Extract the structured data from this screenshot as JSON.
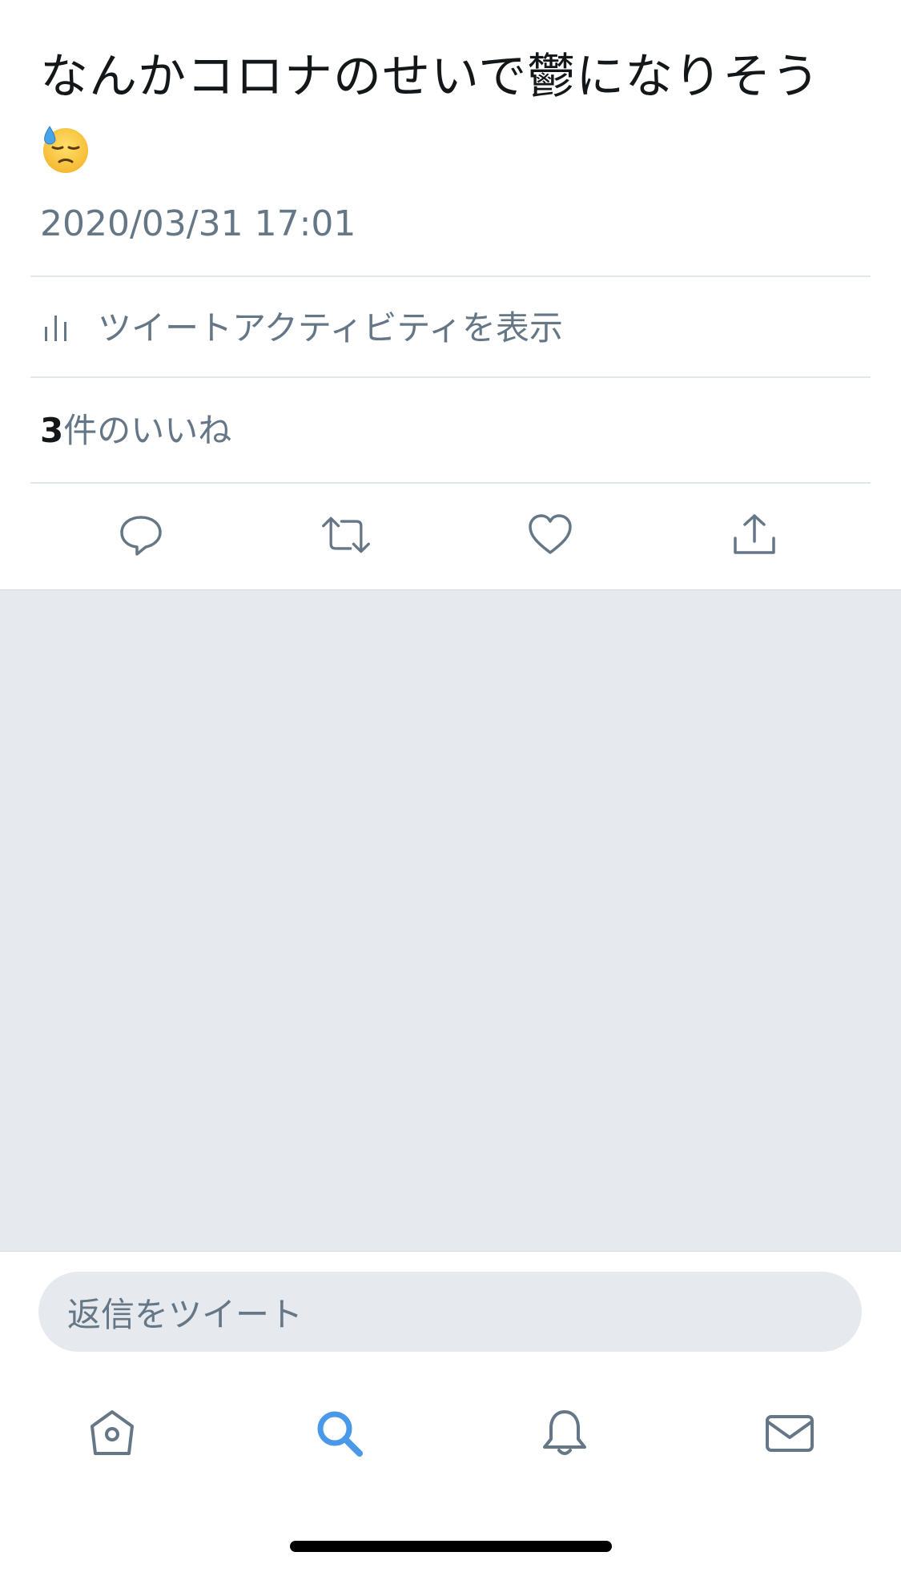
{
  "tweet": {
    "text": "なんかコロナのせいで鬱になりそう",
    "emoji": "downcast-face-with-sweat",
    "timestamp": "2020/03/31 17:01"
  },
  "activity": {
    "label": "ツイートアクティビティを表示",
    "icon": "bar-chart-icon"
  },
  "likes": {
    "count": "3",
    "label": "件のいいね"
  },
  "actions": [
    {
      "name": "reply",
      "icon": "reply-icon"
    },
    {
      "name": "retweet",
      "icon": "retweet-icon"
    },
    {
      "name": "like",
      "icon": "heart-icon"
    },
    {
      "name": "share",
      "icon": "share-icon"
    }
  ],
  "reply_box": {
    "placeholder": "返信をツイート"
  },
  "tabbar": [
    {
      "name": "home",
      "icon": "home-icon",
      "active": false
    },
    {
      "name": "search",
      "icon": "search-icon",
      "active": true
    },
    {
      "name": "notifications",
      "icon": "bell-icon",
      "active": false
    },
    {
      "name": "messages",
      "icon": "mail-icon",
      "active": false
    }
  ],
  "colors": {
    "text": "#14171a",
    "secondary": "#657786",
    "accent": "#4a99e9",
    "divider": "#e1e8ed",
    "background_gray": "#e6e9ee"
  }
}
